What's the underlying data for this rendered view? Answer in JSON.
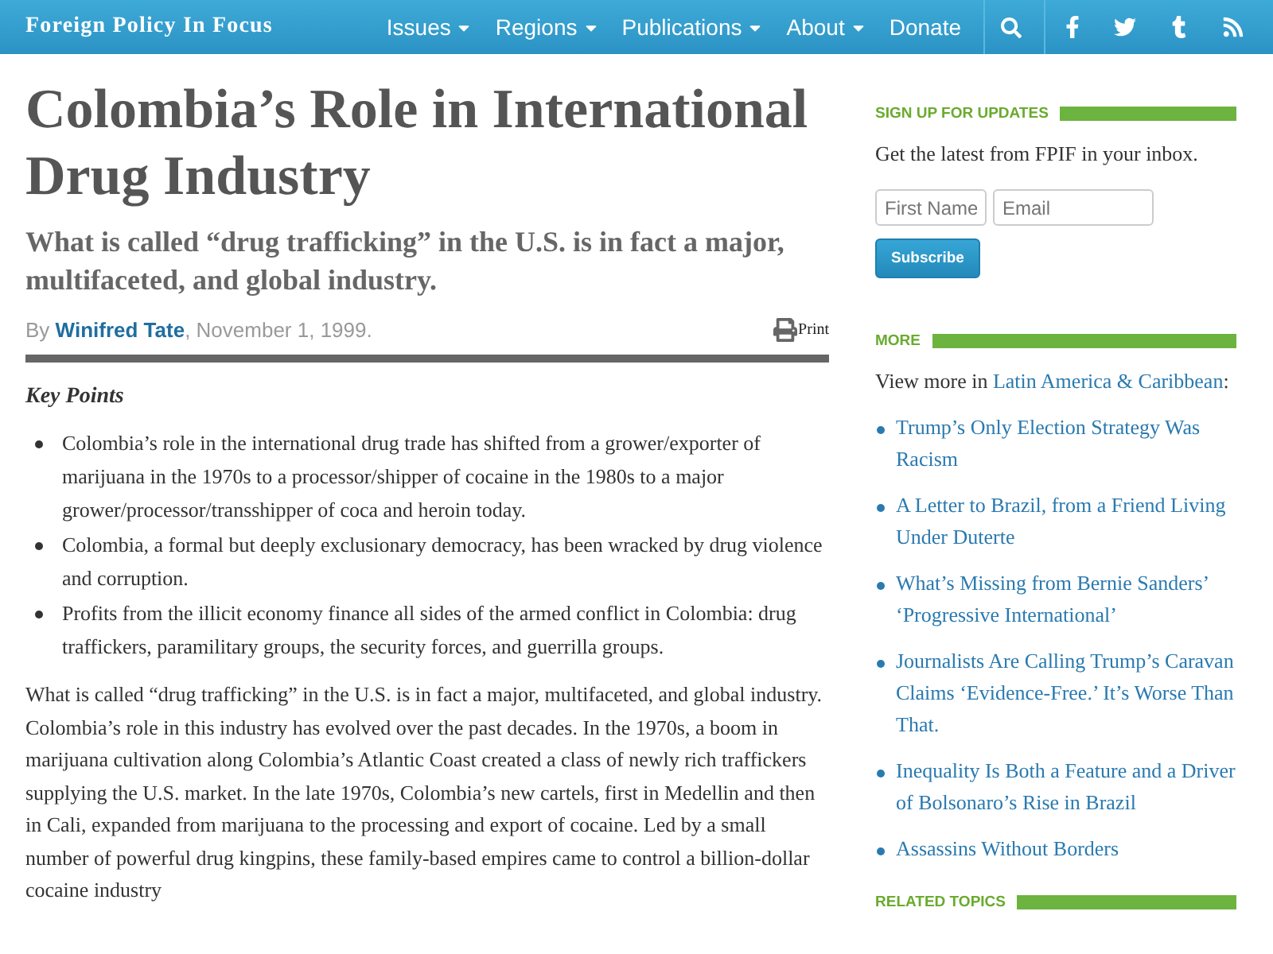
{
  "header": {
    "site_name": "Foreign Policy In Focus",
    "nav": [
      {
        "label": "Issues",
        "dropdown": true
      },
      {
        "label": "Regions",
        "dropdown": true
      },
      {
        "label": "Publications",
        "dropdown": true
      },
      {
        "label": "About",
        "dropdown": true
      },
      {
        "label": "Donate",
        "dropdown": false
      }
    ]
  },
  "article": {
    "title": "Colombia’s Role in International Drug Industry",
    "subtitle": "What is called “drug trafficking” in the U.S. is in fact a major, multifaceted, and global industry.",
    "byline_prefix": "By",
    "author": "Winifred Tate",
    "date": ", November 1, 1999.",
    "print_label": "Print",
    "key_points_heading": "Key Points",
    "key_points": [
      "Colombia’s role in the international drug trade has shifted from a grower/exporter of marijuana in the 1970s to a processor/shipper of cocaine in the 1980s to a major grower/processor/transshipper of coca and heroin today.",
      "Colombia, a formal but deeply exclusionary democracy, has been wracked by drug violence and corruption.",
      "Profits from the illicit economy finance all sides of the armed conflict in Colombia: drug traffickers, paramilitary groups, the security forces, and guerrilla groups."
    ],
    "body": "What is called “drug trafficking” in the U.S. is in fact a major, multifaceted, and global industry. Colombia’s role in this industry has evolved over the past decades. In the 1970s, a boom in marijuana cultivation along Colombia’s Atlantic Coast created a class of newly rich traffickers supplying the U.S. market. In the late 1970s, Colombia’s new cartels, first in Medellin and then in Cali, expanded from marijuana to the processing and export of cocaine. Led by a small number of powerful drug kingpins, these family-based empires came to control a billion-dollar cocaine industry"
  },
  "sidebar": {
    "signup": {
      "heading": "SIGN UP FOR UPDATES",
      "text": "Get the latest from FPIF in your inbox.",
      "first_name_placeholder": "First Name",
      "email_placeholder": "Email",
      "button": "Subscribe"
    },
    "more": {
      "heading": "MORE",
      "intro": "View more in",
      "intro_link": "Latin America & Caribbean",
      "intro_suffix": ":",
      "links": [
        "Trump’s Only Election Strategy Was Racism",
        "A Letter to Brazil, from a Friend Living Under Duterte",
        "What’s Missing from Bernie Sanders’ ‘Progressive International’",
        "Journalists Are Calling Trump’s Caravan Claims ‘Evidence-Free.’ It’s Worse Than That.",
        "Inequality Is Both a Feature and a Driver of Bolsonaro’s Rise in Brazil",
        "Assassins Without Borders"
      ]
    },
    "related_heading": "RELATED TOPICS"
  }
}
